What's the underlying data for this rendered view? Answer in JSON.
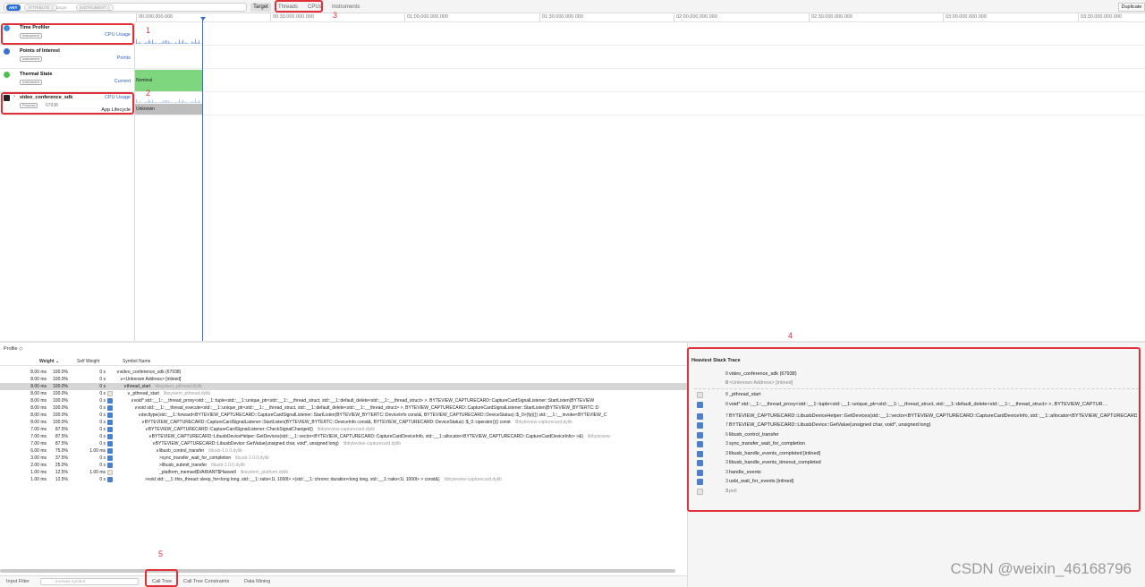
{
  "toolbar": {
    "any_label": "ANY",
    "tokens": [
      "ATTRIBUTE ◇",
      "target",
      "INSTRUMENT ◇"
    ],
    "target_label": "Target",
    "tabs": [
      "Threads",
      "CPUs",
      "Instruments"
    ],
    "duplicate_label": "Duplicate"
  },
  "ruler": {
    "ticks": [
      "00.000.000.000",
      "00:30.000.000.000",
      "01:00.000.000.000",
      "01:30.000.000.000",
      "02:00.000.000.000",
      "02:30.000.000.000",
      "03:00.000.000.000",
      "03:30.000.000.000"
    ]
  },
  "tracks": [
    {
      "title": "Time Profiler",
      "badge": "Instrument",
      "right": "CPU Usage",
      "icon_color": "#3b8fe0"
    },
    {
      "title": "Points of Interest",
      "badge": "Instrument",
      "right": "Points",
      "icon_color": "#3b6fd0"
    },
    {
      "title": "Thermal State",
      "badge": "Instrument",
      "right": "Current",
      "icon_color": "#4cc24c"
    },
    {
      "title": "video_conference_sdk",
      "badge": "Process",
      "pid": "67938",
      "right": "CPU Usage",
      "right2": "App Lifecycle",
      "icon_color": "#222222"
    }
  ],
  "lanes": {
    "thermal_state": "Nominal",
    "lifecycle_state": "Unknown",
    "thermal_color": "#7ed67e",
    "lifecycle_color": "#bdbdbd"
  },
  "annotations": [
    "1",
    "2",
    "3",
    "4",
    "5"
  ],
  "profile": {
    "mode_label": "Profile ◇",
    "columns": {
      "weight": "Weight ⌄",
      "self_weight": "Self Weight",
      "symbol": "Symbol Name"
    },
    "rows": [
      {
        "weight": "8.00 ms",
        "pct": "100.0%",
        "self": "0 s",
        "icon": "none",
        "indent": 0,
        "symbol": "∨video_conference_sdk (67938)",
        "lib": ""
      },
      {
        "weight": "8.00 ms",
        "pct": "100.0%",
        "self": "0 s",
        "icon": "none",
        "indent": 1,
        "symbol": "∨<Unknown Address> [inlined]",
        "lib": ""
      },
      {
        "weight": "8.00 ms",
        "pct": "100.0%",
        "self": "0 s",
        "icon": "none",
        "indent": 2,
        "symbol": "∨thread_start",
        "lib": "libsystem_pthread.dylib",
        "selected": true
      },
      {
        "weight": "8.00 ms",
        "pct": "100.0%",
        "self": "0 s",
        "icon": "sys",
        "indent": 3,
        "symbol": "∨_pthread_start",
        "lib": "libsystem_pthread.dylib"
      },
      {
        "weight": "8.00 ms",
        "pct": "100.0%",
        "self": "0 s",
        "icon": "user",
        "indent": 4,
        "symbol": "∨void* std::__1::__thread_proxy<std::__1::tuple<std::__1::unique_ptr<std::__1::__thread_struct, std::__1::default_delete<std::__1::__thread_struct> >, BYTEVIEW_CAPTURECARD::CaptureCardSignalListener::StartListen(BYTEVIEW",
        "lib": ""
      },
      {
        "weight": "8.00 ms",
        "pct": "100.0%",
        "self": "0 s",
        "icon": "user",
        "indent": 5,
        "symbol": "∨void std::__1::__thread_execute<std::__1::unique_ptr<std::__1::__thread_struct, std::__1::default_delete<std::__1::__thread_struct> >, BYTEVIEW_CAPTURECARD::CaptureCardSignalListener::StartListen(BYTEVIEW_BYTERTC::D",
        "lib": ""
      },
      {
        "weight": "8.00 ms",
        "pct": "100.0%",
        "self": "0 s",
        "icon": "user",
        "indent": 6,
        "symbol": "∨decltype(std::__1::forward<BYTEVIEW_CAPTURECARD::CaptureCardSignalListener::StartListen(BYTEVIEW_BYTERTC::DeviceInfo const&, BYTEVIEW_CAPTURECARD::DeviceStatus)::$_0>(fp)()) std::__1::__invoke<BYTEVIEW_C",
        "lib": ""
      },
      {
        "weight": "8.00 ms",
        "pct": "100.0%",
        "self": "0 s",
        "icon": "user",
        "indent": 7,
        "symbol": "∨BYTEVIEW_CAPTURECARD::CaptureCardSignalListener::StartListen(BYTEVIEW_BYTERTC::DeviceInfo const&, BYTEVIEW_CAPTURECARD::DeviceStatus)::$_0::operator()() const",
        "lib": "libbyteview-capturecard.dylib"
      },
      {
        "weight": "7.00 ms",
        "pct": "87.5%",
        "self": "0 s",
        "icon": "user",
        "indent": 8,
        "symbol": "∨BYTEVIEW_CAPTURECARD::CaptureCardSignalListener::CheckSignalChanged()",
        "lib": "libbyteview-capturecard.dylib"
      },
      {
        "weight": "7.00 ms",
        "pct": "87.5%",
        "self": "0 s",
        "icon": "user",
        "indent": 9,
        "symbol": "∨BYTEVIEW_CAPTURECARD::LibusbDeviceHelper::GetDevices(std::__1::vector<BYTEVIEW_CAPTURECARD::CaptureCardDeviceInfo, std::__1::allocator<BYTEVIEW_CAPTURECARD::CaptureCardDeviceInfo> >&)",
        "lib": "libbyteview-"
      },
      {
        "weight": "7.00 ms",
        "pct": "87.5%",
        "self": "0 s",
        "icon": "user",
        "indent": 10,
        "symbol": "∨BYTEVIEW_CAPTURECARD::LibusbDevice::GetValue(unsigned char, void*, unsigned long)",
        "lib": "libbyteview-capturecard.dylib"
      },
      {
        "weight": "6.00 ms",
        "pct": "75.0%",
        "self": "1.00 ms",
        "icon": "user",
        "indent": 11,
        "symbol": "∨libusb_control_transfer",
        "lib": "libusb-1.0.0.dylib"
      },
      {
        "weight": "3.00 ms",
        "pct": "37.5%",
        "self": "0 s",
        "icon": "user",
        "indent": 12,
        "symbol": ">sync_transfer_wait_for_completion",
        "lib": "libusb-1.0.0.dylib"
      },
      {
        "weight": "2.00 ms",
        "pct": "25.0%",
        "self": "0 s",
        "icon": "user",
        "indent": 12,
        "symbol": ">libusb_submit_transfer",
        "lib": "libusb-1.0.0.dylib"
      },
      {
        "weight": "1.00 ms",
        "pct": "12.5%",
        "self": "1.00 ms",
        "icon": "sys",
        "indent": 12,
        "symbol": "_platform_memset$VARIANT$Haswell",
        "lib": "libsystem_platform.dylib"
      },
      {
        "weight": "1.00 ms",
        "pct": "12.5%",
        "self": "0 s",
        "icon": "user",
        "indent": 8,
        "symbol": ">void std::__1::this_thread::sleep_for<long long, std::__1::ratio<1l, 1000l> >(std::__1::chrono::duration<long long, std::__1::ratio<1l, 1000l> > const&)",
        "lib": "libbyteview-capturecard.dylib"
      }
    ]
  },
  "heaviest": {
    "title": "Heaviest Stack Trace",
    "rows": [
      {
        "count": "8",
        "icon": "none",
        "symbol": "video_conference_sdk (67938)",
        "muted": false
      },
      {
        "count": "8",
        "icon": "none",
        "symbol": "<Unknown Address> [inlined]",
        "muted": true
      },
      {
        "count": "8",
        "icon": "sys",
        "symbol": "_pthread_start",
        "muted": false
      },
      {
        "count": "8",
        "icon": "user",
        "symbol": "void* std::__1::__thread_proxy<std::__1::tuple<std::__1::unique_ptr<std::__1::__thread_struct, std::__1::default_delete<std::__1::__thread_struct> >, BYTEVIEW_CAPTUR…",
        "muted": false
      },
      {
        "count": "7",
        "icon": "user",
        "symbol": "BYTEVIEW_CAPTURECARD::LibusbDeviceHelper::GetDevices(std::__1::vector<BYTEVIEW_CAPTURECARD::CaptureCardDeviceInfo, std::__1::allocator<BYTEVIEW_CAPTURECARD::CaptureCardDeviceIn…",
        "muted": false
      },
      {
        "count": "7",
        "icon": "user",
        "symbol": "BYTEVIEW_CAPTURECARD::LibusbDevice::GetValue(unsigned char, void*, unsigned long)",
        "muted": false
      },
      {
        "count": "6",
        "icon": "user",
        "symbol": "libusb_control_transfer",
        "muted": false
      },
      {
        "count": "3",
        "icon": "user",
        "symbol": "sync_transfer_wait_for_completion",
        "muted": false
      },
      {
        "count": "3",
        "icon": "user",
        "symbol": "libusb_handle_events_completed [inlined]",
        "muted": false
      },
      {
        "count": "3",
        "icon": "user",
        "symbol": "libusb_handle_events_timeout_completed",
        "muted": false
      },
      {
        "count": "3",
        "icon": "user",
        "symbol": "handle_events",
        "muted": false
      },
      {
        "count": "3",
        "icon": "user",
        "symbol": "usbi_wait_for_events [inlined]",
        "muted": false
      },
      {
        "count": "3",
        "icon": "sys",
        "symbol": "poll",
        "muted": true
      }
    ]
  },
  "bottombar": {
    "input_filter": "Input Filter",
    "involves_placeholder": "Involves Symbol",
    "tabs": [
      "Call Tree",
      "Call Tree Constraints",
      "Data Mining"
    ]
  },
  "watermark": "CSDN @weixin_46168796"
}
